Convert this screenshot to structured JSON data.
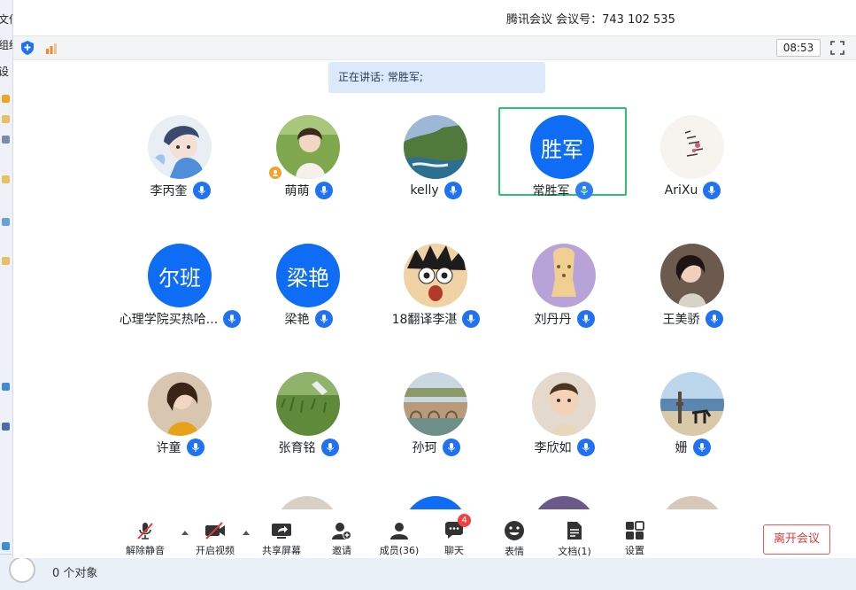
{
  "title": "腾讯会议 会议号：743 102 535",
  "timer": "08:53",
  "speaking": "正在讲话: 常胜军;",
  "participants": [
    {
      "name": "李丙奎",
      "avatar": "photo"
    },
    {
      "name": "萌萌",
      "avatar": "photo",
      "host": true
    },
    {
      "name": "kelly",
      "avatar": "photo"
    },
    {
      "name": "常胜军",
      "avatar_text": "胜军",
      "speaking": true
    },
    {
      "name": "AriXu",
      "avatar": "photo"
    },
    {
      "name": "心理学院买热哈...",
      "avatar_text": "尔班"
    },
    {
      "name": "梁艳",
      "avatar_text": "梁艳"
    },
    {
      "name": "18翻译李湛",
      "avatar": "photo"
    },
    {
      "name": "刘丹丹",
      "avatar": "photo"
    },
    {
      "name": "王美骄",
      "avatar": "photo"
    },
    {
      "name": "许童",
      "avatar": "photo"
    },
    {
      "name": "张育铭",
      "avatar": "photo"
    },
    {
      "name": "孙珂",
      "avatar": "photo"
    },
    {
      "name": "李欣如",
      "avatar": "photo"
    },
    {
      "name": "姗",
      "avatar": "photo"
    }
  ],
  "controls": {
    "unmute": "解除静音",
    "video": "开启视频",
    "share": "共享屏幕",
    "invite": "邀请",
    "members": "成员(36)",
    "chat": "聊天",
    "chat_badge": "4",
    "emoji": "表情",
    "docs": "文档(1)",
    "settings": "设置",
    "leave": "离开会议"
  },
  "background": {
    "fragments": [
      "文件",
      "组织",
      "设"
    ],
    "status_text": "0 个对象"
  },
  "colors": {
    "accent": "#0e6cf5",
    "speaker_border": "#2fc26a",
    "leave": "#e03b3b"
  }
}
